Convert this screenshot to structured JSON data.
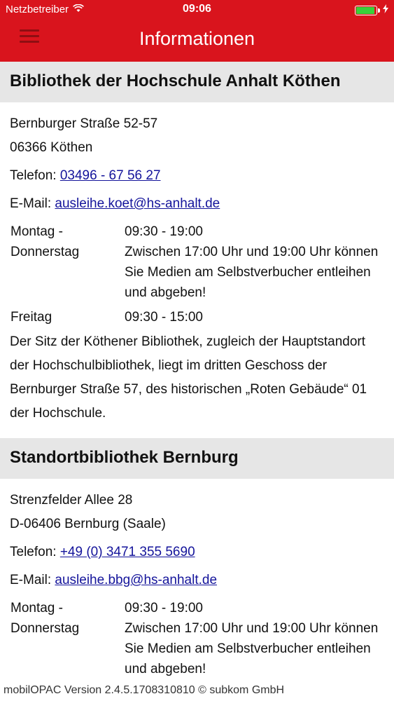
{
  "status_bar": {
    "carrier": "Netzbetreiber",
    "time": "09:06",
    "wifi_icon": "wifi-icon",
    "battery_icon": "battery-icon",
    "charging_icon": "charging-bolt-icon"
  },
  "header": {
    "title": "Informationen",
    "menu_icon": "hamburger-menu-icon",
    "background_color": "#d9141d"
  },
  "libraries": [
    {
      "name": "Bibliothek der Hochschule Anhalt Köthen",
      "address_line1": "Bernburger Straße 52-57",
      "address_line2": "06366 Köthen",
      "phone_label": "Telefon:",
      "phone": "03496 - 67 56 27",
      "email_label": "E-Mail:",
      "email": "ausleihe.koet@hs-anhalt.de",
      "hours": [
        {
          "day_line1": "Montag -",
          "day_line2": "Donnerstag",
          "time": "09:30 - 19:00",
          "note": "Zwischen 17:00 Uhr und 19:00 Uhr können Sie Medien am Selbstverbucher entleihen und abgeben!"
        },
        {
          "day_line1": "Freitag",
          "time": "09:30 - 15:00"
        }
      ],
      "description": "Der Sitz der Köthener Bibliothek, zugleich der Hauptstandort der Hochschulbibliothek, liegt im dritten Geschoss der Bernburger Straße 57, des historischen „Roten Gebäude“ 01 der Hochschule."
    },
    {
      "name": "Standortbibliothek Bernburg",
      "address_line1": "Strenzfelder Allee 28",
      "address_line2": "D-06406 Bernburg (Saale)",
      "phone_label": "Telefon:",
      "phone": "+49 (0) 3471 355 5690",
      "email_label": "E-Mail:",
      "email": "ausleihe.bbg@hs-anhalt.de",
      "hours": [
        {
          "day_line1": "Montag -",
          "day_line2": "Donnerstag",
          "time": "09:30 - 19:00",
          "note": "Zwischen 17:00 Uhr und 19:00 Uhr können Sie Medien am Selbstverbucher entleihen und abgeben!"
        }
      ]
    }
  ],
  "footer": {
    "text": "mobilOPAC Version 2.4.5.1708310810 © subkom GmbH"
  }
}
